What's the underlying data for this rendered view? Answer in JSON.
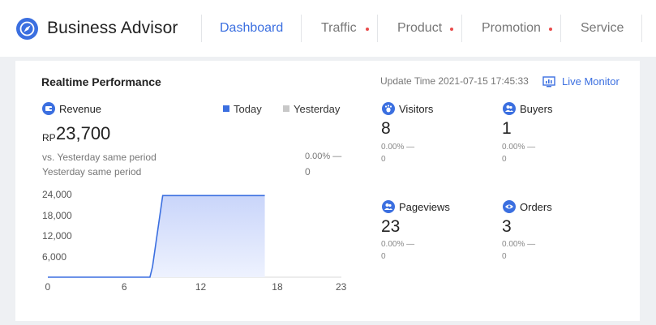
{
  "header": {
    "brand": "Business Advisor",
    "nav": [
      {
        "label": "Dashboard",
        "active": true,
        "dot": false
      },
      {
        "label": "Traffic",
        "active": false,
        "dot": true
      },
      {
        "label": "Product",
        "active": false,
        "dot": true
      },
      {
        "label": "Promotion",
        "active": false,
        "dot": true
      },
      {
        "label": "Service",
        "active": false,
        "dot": false
      }
    ]
  },
  "card": {
    "title": "Realtime Performance",
    "update_time": "Update Time 2021-07-15 17:45:33",
    "live_monitor": "Live Monitor"
  },
  "revenue": {
    "label": "Revenue",
    "currency": "RP",
    "value": "23,700",
    "vs_label": "vs. Yesterday same period",
    "vs_value": "0.00% —",
    "yesterday_label": "Yesterday same period",
    "yesterday_value": "0"
  },
  "legend": {
    "today": "Today",
    "yesterday": "Yesterday"
  },
  "metrics": {
    "visitors": {
      "label": "Visitors",
      "value": "8",
      "change": "0.00% —",
      "prev": "0"
    },
    "buyers": {
      "label": "Buyers",
      "value": "1",
      "change": "0.00% —",
      "prev": "0"
    },
    "pageviews": {
      "label": "Pageviews",
      "value": "23",
      "change": "0.00% —",
      "prev": "0"
    },
    "orders": {
      "label": "Orders",
      "value": "3",
      "change": "0.00% —",
      "prev": "0"
    }
  },
  "colors": {
    "accent": "#3b6fe0",
    "dot": "#e94b4b",
    "yesterday": "#c8c8c8"
  },
  "chart_data": {
    "type": "area",
    "x_ticks": [
      "0",
      "6",
      "12",
      "18",
      "23"
    ],
    "y_ticks": [
      "24,000",
      "18,000",
      "12,000",
      "6,000"
    ],
    "xlim": [
      0,
      23
    ],
    "ylim": [
      0,
      24000
    ],
    "series": [
      {
        "name": "Today",
        "x": [
          0,
          8,
          8.2,
          9,
          17
        ],
        "y": [
          0,
          0,
          3000,
          23700,
          23700
        ]
      }
    ]
  }
}
